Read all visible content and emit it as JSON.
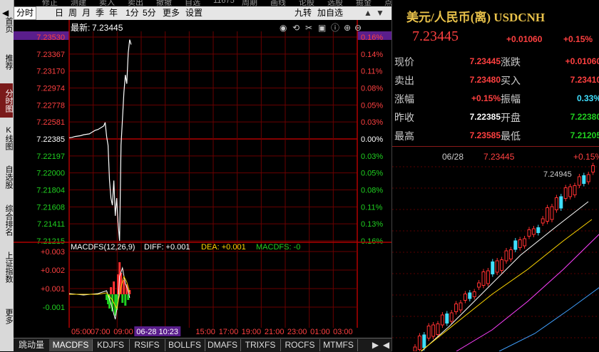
{
  "top_strip": [
    "修正",
    "测建",
    "卖入",
    "卖出",
    "撤撤",
    "自选",
    "11675",
    "周期",
    "画线",
    "论股",
    "选股",
    "掘金",
    "点将"
  ],
  "sidebar": {
    "items": [
      {
        "label": "首页",
        "active": false
      },
      {
        "label": "推荐",
        "active": false
      },
      {
        "label": "分时图",
        "active": true
      },
      {
        "label": "K线图",
        "active": false
      },
      {
        "label": "自选股",
        "active": false
      },
      {
        "label": "综合排名",
        "active": false
      },
      {
        "label": "上证指数",
        "active": false
      },
      {
        "label": "更多",
        "active": false
      }
    ]
  },
  "toolbar": {
    "items": [
      {
        "label": "分时",
        "active": true
      },
      {
        "label": "日",
        "active": false
      },
      {
        "label": "周",
        "active": false
      },
      {
        "label": "月",
        "active": false
      },
      {
        "label": "季",
        "active": false
      },
      {
        "label": "年",
        "active": false
      },
      {
        "label": "1分",
        "active": false
      },
      {
        "label": "5分",
        "active": false
      },
      {
        "label": "更多",
        "active": false
      },
      {
        "label": "设置",
        "active": false
      }
    ],
    "right_items": [
      "九转",
      "加自选"
    ]
  },
  "price_panel": {
    "latest_label": "最新:",
    "latest_value": "7.23445",
    "left_ticks": [
      "7.23530",
      "7.23367",
      "7.23170",
      "7.22974",
      "7.22778",
      "7.22581",
      "7.22385",
      "7.22197",
      "7.22000",
      "7.21804",
      "7.21608",
      "7.21411",
      "7.21215"
    ],
    "right_ticks": [
      "0.16%",
      "0.14%",
      "0.11%",
      "0.08%",
      "0.05%",
      "0.03%",
      "0.00%",
      "0.03%",
      "0.05%",
      "0.08%",
      "0.11%",
      "0.13%",
      "0.16%"
    ]
  },
  "macd_panel": {
    "title": "MACDFS(12,26,9)",
    "diff_label": "DIFF: +0.001",
    "dea_label": "DEA: +0.001",
    "macd_label": "MACDFS: -0",
    "ticks": [
      "+0.003",
      "+0.002",
      "+0.001",
      "-0.001"
    ]
  },
  "time_axis": {
    "labels": [
      "05:00",
      "07:00",
      "09:00",
      "15:00",
      "17:00",
      "19:00",
      "21:00",
      "23:00",
      "01:00",
      "03:00"
    ],
    "cursor_label": "06-28 10:23"
  },
  "bottom_tabs": {
    "items": [
      {
        "label": "跳动量",
        "active": false
      },
      {
        "label": "MACDFS",
        "active": true
      },
      {
        "label": "KDJFS",
        "active": false
      },
      {
        "label": "RSIFS",
        "active": false
      },
      {
        "label": "BOLLFS",
        "active": false
      },
      {
        "label": "DMAFS",
        "active": false
      },
      {
        "label": "TRIXFS",
        "active": false
      },
      {
        "label": "ROCFS",
        "active": false
      },
      {
        "label": "MTMFS",
        "active": false
      }
    ]
  },
  "quote": {
    "title": "美元/人民币(离) USDCNH",
    "price": "7.23445",
    "change": "+0.01060",
    "change_pct": "+0.15%",
    "rows": [
      {
        "l1": "现价",
        "v1": "7.23445",
        "c1": "red",
        "l2": "涨跌",
        "v2": "+0.01060",
        "c2": "red"
      },
      {
        "l1": "卖出",
        "v1": "7.23480",
        "c1": "red",
        "l2": "买入",
        "v2": "7.23410",
        "c2": "red"
      },
      {
        "l1": "涨幅",
        "v1": "+0.15%",
        "c1": "red",
        "l2": "振幅",
        "v2": "0.33%",
        "c2": "cyan"
      },
      {
        "l1": "昨收",
        "v1": "7.22385",
        "c1": "white",
        "l2": "开盘",
        "v2": "7.22380",
        "c2": "green"
      },
      {
        "l1": "最高",
        "v1": "7.23585",
        "c1": "red",
        "l2": "最低",
        "v2": "7.21205",
        "c2": "green"
      }
    ],
    "mini_date": "06/28",
    "mini_price": "7.23445",
    "mini_pct": "+0.15%",
    "mini_high_label": "7.24945"
  },
  "colors": {
    "up": "#ff4040",
    "down": "#20d020",
    "grid": "#6a0000",
    "accent": "#e8c14a"
  }
}
